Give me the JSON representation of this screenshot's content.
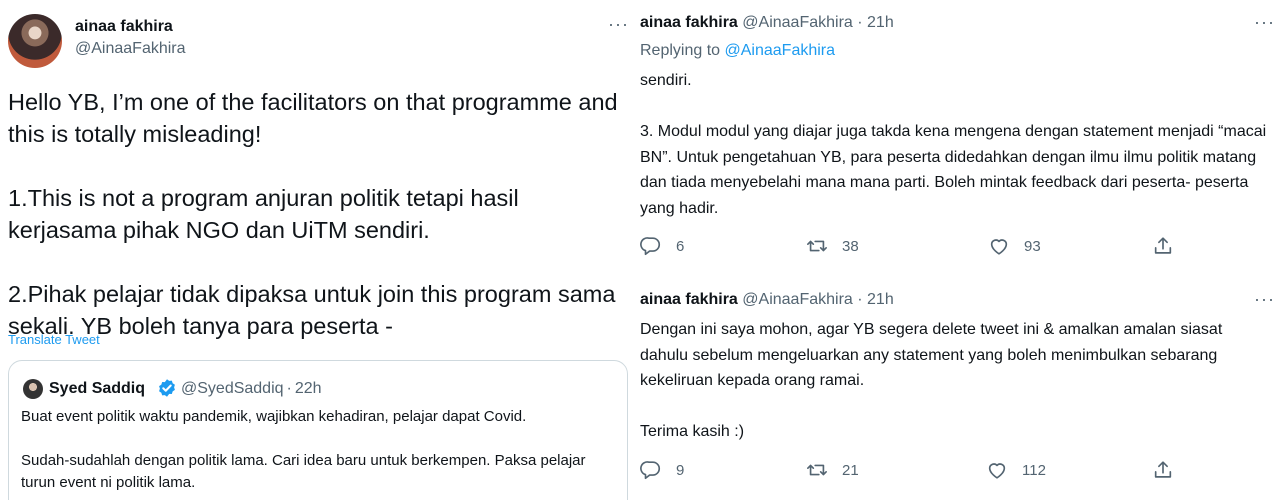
{
  "left_tweet": {
    "display_name": "ainaa fakhira",
    "handle": "@AinaaFakhira",
    "more": "···",
    "paragraphs": [
      "Hello YB, I’m one of the facilitators on that programme and this is totally misleading!",
      "1.This is not a program anjuran politik tetapi hasil kerjasama pihak NGO dan UiTM sendiri.",
      "2.Pihak pelajar tidak dipaksa untuk join this program sama sekali. YB boleh tanya para peserta -"
    ],
    "translate": "Translate Tweet",
    "quote": {
      "display_name": "Syed Saddiq",
      "handle": "@SyedSaddiq",
      "separator": "·",
      "time": "22h",
      "paragraphs": [
        "Buat event politik waktu pandemik, wajibkan kehadiran, pelajar dapat Covid.",
        "Sudah-sudahlah dengan politik lama. Cari idea baru untuk berkempen. Paksa pelajar turun event ni politik lama."
      ]
    }
  },
  "right_tweets": [
    {
      "display_name": "ainaa fakhira",
      "handle": "@AinaaFakhira",
      "separator": "·",
      "time": "21h",
      "more": "···",
      "replying_prefix": "Replying to ",
      "replying_to": "@AinaaFakhira",
      "text": "sendiri.\n\n3. Modul modul yang diajar juga takda kena mengena dengan statement menjadi “macai  BN”. Untuk pengetahuan YB, para peserta didedahkan dengan ilmu ilmu politik matang dan tiada menyebelahi mana mana parti. Boleh mintak feedback dari peserta- peserta yang hadir.",
      "replies": "6",
      "retweets": "38",
      "likes": "93"
    },
    {
      "display_name": "ainaa fakhira",
      "handle": "@AinaaFakhira",
      "separator": "·",
      "time": "21h",
      "more": "···",
      "text": "Dengan ini saya mohon, agar YB segera delete tweet ini & amalkan amalan siasat dahulu sebelum mengeluarkan any statement yang boleh menimbulkan sebarang kekeliruan kepada orang ramai.\n\nTerima kasih :)",
      "replies": "9",
      "retweets": "21",
      "likes": "112"
    }
  ],
  "colors": {
    "link": "#1d9bf0",
    "muted": "#536471",
    "text": "#0f1419",
    "border": "#cfd9de"
  },
  "icons": [
    "reply-icon",
    "retweet-icon",
    "like-icon",
    "share-icon",
    "verified-badge-icon",
    "more-icon"
  ]
}
